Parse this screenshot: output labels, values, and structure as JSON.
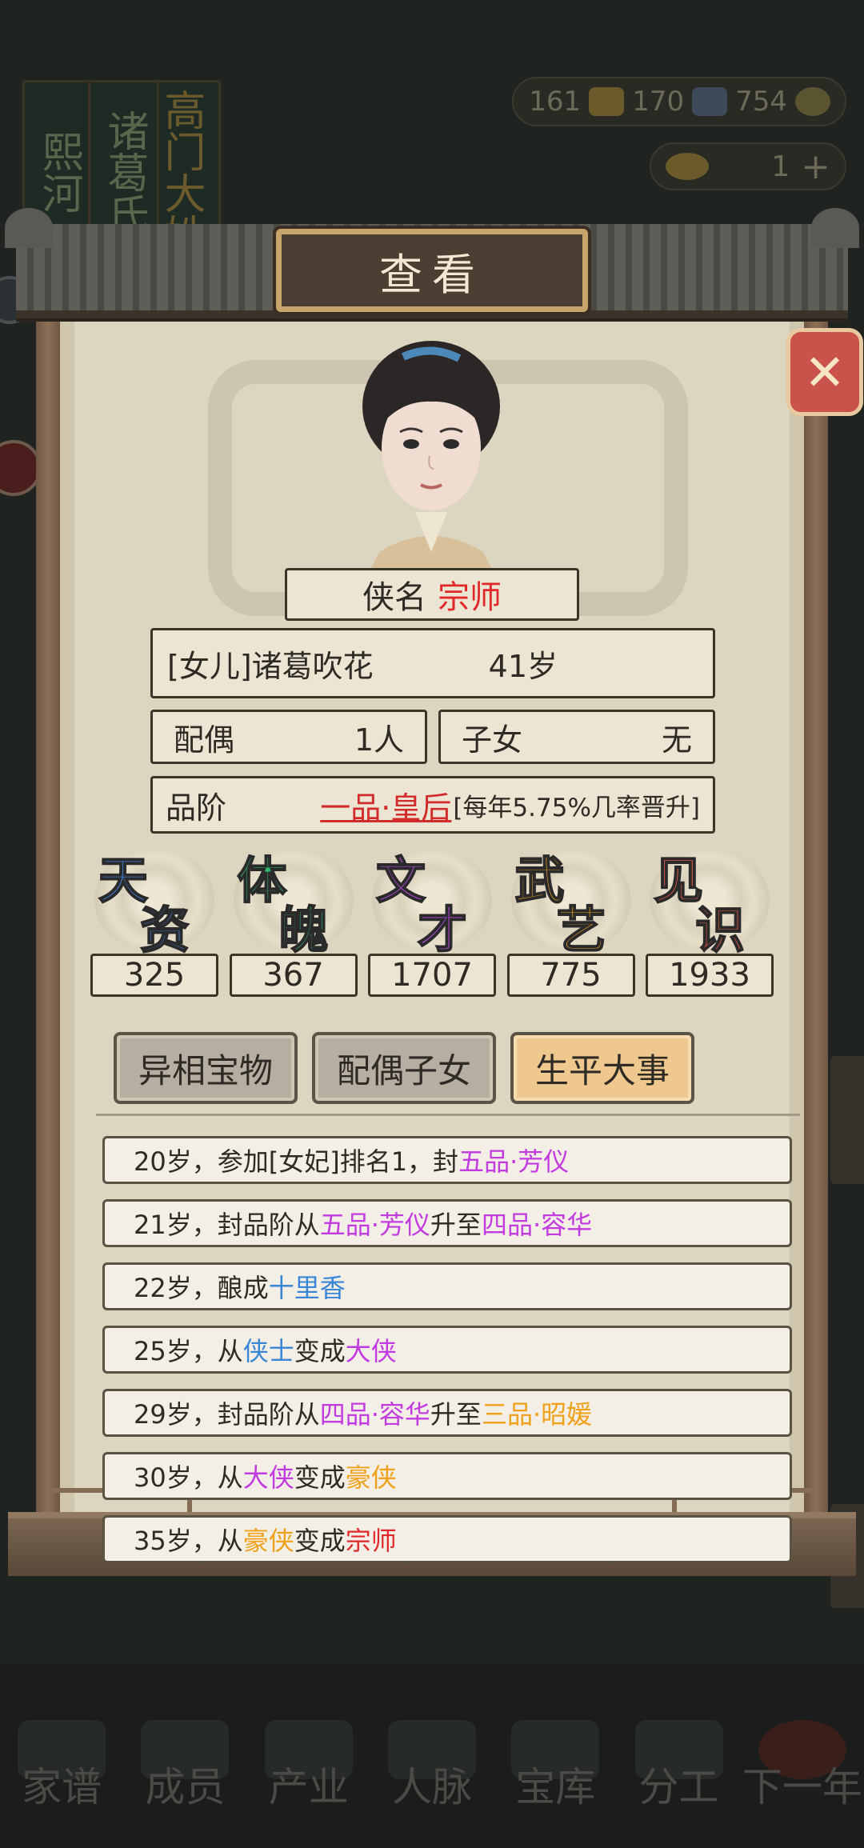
{
  "background": {
    "banners": [
      "熙河",
      "诸葛氏",
      "高门大姓"
    ],
    "resources": {
      "stones": "161",
      "gold_bars": "170",
      "coins": "754"
    },
    "ingots": "1",
    "bottom_nav": [
      "家谱",
      "成员",
      "产业",
      "人脉",
      "宝库",
      "分工",
      "下一年"
    ]
  },
  "dialog": {
    "title": "查看",
    "close_glyph": "✕",
    "title_label": "侠名",
    "title_rank": "宗师",
    "identity": "[女儿]诸葛吹花",
    "age": "41岁",
    "spouse_label": "配偶",
    "spouse_value": "1人",
    "children_label": "子女",
    "children_value": "无",
    "grade_label": "品阶",
    "grade_value": "一品·皇后",
    "grade_promo": "[每年5.75%几率晋升]",
    "stats": [
      {
        "g1": "天",
        "g2": "资",
        "color1": "#3f7fd9",
        "color2": "#3f7fd9",
        "value": "325"
      },
      {
        "g1": "体",
        "g2": "魄",
        "color1": "#2fb56e",
        "color2": "#2fb56e",
        "value": "367"
      },
      {
        "g1": "文",
        "g2": "才",
        "color1": "#b14ad8",
        "color2": "#b14ad8",
        "value": "1707"
      },
      {
        "g1": "武",
        "g2": "艺",
        "color1": "#e6a01f",
        "color2": "#e6a01f",
        "value": "775"
      },
      {
        "g1": "见",
        "g2": "识",
        "color1": "#e25a45",
        "color2": "#e25a45",
        "value": "1933"
      }
    ],
    "tabs": [
      "异相宝物",
      "配偶子女",
      "生平大事"
    ],
    "active_tab": "生平大事",
    "events": [
      [
        {
          "t": "20岁，参加[女妃]排名1，封",
          "c": ""
        },
        {
          "t": "五品·芳仪",
          "c": "purple"
        }
      ],
      [
        {
          "t": "21岁，封品阶从",
          "c": ""
        },
        {
          "t": "五品·芳仪",
          "c": "purple"
        },
        {
          "t": "升至",
          "c": ""
        },
        {
          "t": "四品·容华",
          "c": "purple"
        }
      ],
      [
        {
          "t": "22岁，酿成",
          "c": ""
        },
        {
          "t": "十里香",
          "c": "blue"
        }
      ],
      [
        {
          "t": "25岁，从",
          "c": ""
        },
        {
          "t": "侠士",
          "c": "blue"
        },
        {
          "t": "变成",
          "c": ""
        },
        {
          "t": "大侠",
          "c": "purple"
        }
      ],
      [
        {
          "t": "29岁，封品阶从",
          "c": ""
        },
        {
          "t": "四品·容华",
          "c": "purple"
        },
        {
          "t": "升至",
          "c": ""
        },
        {
          "t": "三品·昭媛",
          "c": "orange"
        }
      ],
      [
        {
          "t": "30岁，从",
          "c": ""
        },
        {
          "t": "大侠",
          "c": "purple"
        },
        {
          "t": "变成",
          "c": ""
        },
        {
          "t": "豪侠",
          "c": "orange"
        }
      ],
      [
        {
          "t": "35岁，从",
          "c": ""
        },
        {
          "t": "豪侠",
          "c": "orange"
        },
        {
          "t": "变成",
          "c": ""
        },
        {
          "t": "宗师",
          "c": "red"
        }
      ]
    ]
  }
}
